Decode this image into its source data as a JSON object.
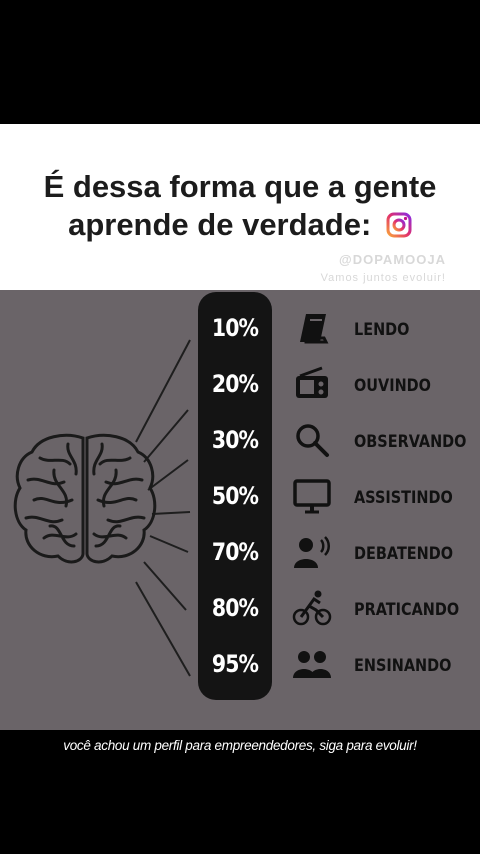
{
  "post": {
    "title_line1": "É dessa forma que a gente",
    "title_line2": "aprende de verdade:",
    "watermark_handle": "@DOPAMOOJA",
    "watermark_sub": "Vamos juntos evoluir!",
    "caption": "você achou um perfil para empreendedores, siga para evoluir!"
  },
  "learning": {
    "items": [
      {
        "percent": "10%",
        "label": "LENDO",
        "icon": "book-icon"
      },
      {
        "percent": "20%",
        "label": "OUVINDO",
        "icon": "radio-icon"
      },
      {
        "percent": "30%",
        "label": "OBSERVANDO",
        "icon": "magnifier-icon"
      },
      {
        "percent": "50%",
        "label": "ASSISTINDO",
        "icon": "monitor-icon"
      },
      {
        "percent": "70%",
        "label": "DEBATENDO",
        "icon": "speaking-person-icon"
      },
      {
        "percent": "80%",
        "label": "PRATICANDO",
        "icon": "cyclist-icon"
      },
      {
        "percent": "95%",
        "label": "ENSINANDO",
        "icon": "people-icon"
      }
    ]
  },
  "colors": {
    "infographic_bg": "#6a6468",
    "pill": "#141414",
    "instagram_gradient_start": "#f9a33a",
    "instagram_gradient_end": "#c2108c"
  }
}
